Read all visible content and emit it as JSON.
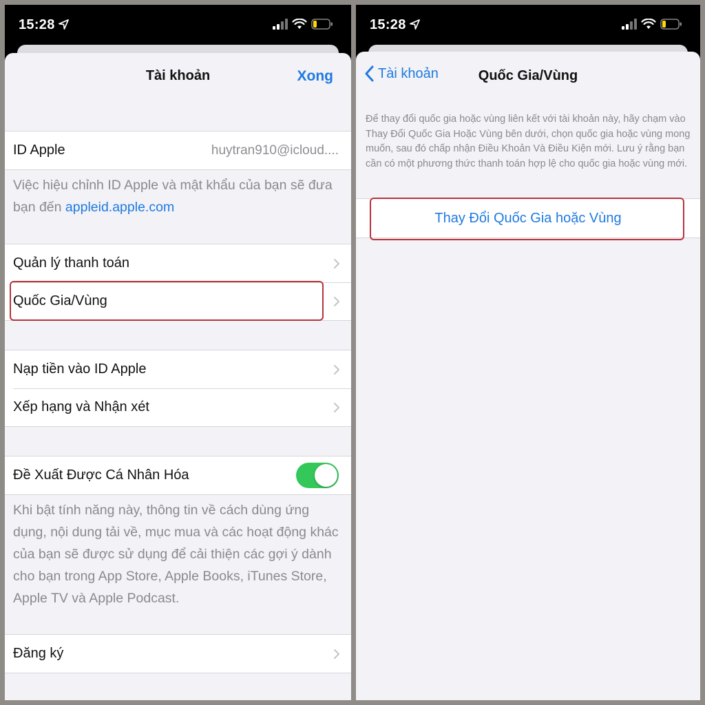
{
  "status": {
    "time": "15:28",
    "icons": [
      "location-arrow-icon",
      "cellular-signal-icon",
      "wifi-icon",
      "battery-icon"
    ],
    "battery_color": "#ffd60a"
  },
  "colors": {
    "accent": "#1f7ae0",
    "toggle_on": "#34c759",
    "highlight": "#b8323a"
  },
  "account_screen": {
    "title": "Tài khoản",
    "done": "Xong",
    "apple_id": {
      "label": "ID Apple",
      "value": "huytran910@icloud...."
    },
    "apple_id_note_text": "Việc hiệu chỉnh ID Apple và mật khẩu của bạn sẽ đưa bạn đến ",
    "apple_id_note_link": "appleid.apple.com",
    "manage_payment": "Quản lý thanh toán",
    "country_region": "Quốc Gia/Vùng",
    "add_funds": "Nạp tiền vào ID Apple",
    "ratings_reviews": "Xếp hạng và Nhận xét",
    "personalized": {
      "label": "Đề Xuất Được Cá Nhân Hóa",
      "enabled": true
    },
    "personalized_note": "Khi bật tính năng này, thông tin về cách dùng ứng dụng, nội dung tải về, mục mua và các hoạt động khác của bạn sẽ được sử dụng để cải thiện các gợi ý dành cho bạn trong App Store, Apple Books, iTunes Store, Apple TV và Apple Podcast.",
    "subscriptions": "Đăng ký"
  },
  "country_screen": {
    "back": "Tài khoản",
    "title": "Quốc Gia/Vùng",
    "info": "Để thay đổi quốc gia hoặc vùng liên kết với tài khoản này, hãy chạm vào Thay Đổi Quốc Gia Hoặc Vùng bên dưới, chọn quốc gia hoặc vùng mong muốn, sau đó chấp nhận Điều Khoản Và Điều Kiện mới. Lưu ý rằng bạn cần có một phương thức thanh toán hợp lệ cho quốc gia hoặc vùng mới.",
    "change_button": "Thay Đổi Quốc Gia hoặc Vùng"
  }
}
